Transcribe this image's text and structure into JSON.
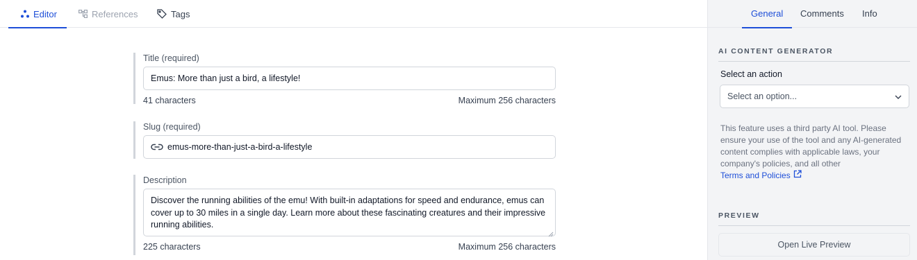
{
  "editor_tabs": {
    "editor": "Editor",
    "references": "References",
    "tags": "Tags"
  },
  "form": {
    "title": {
      "label": "Title (required)",
      "value": "Emus: More than just a bird, a lifestyle!",
      "count": "41 characters",
      "max": "Maximum 256 characters"
    },
    "slug": {
      "label": "Slug (required)",
      "value": "emus-more-than-just-a-bird-a-lifestyle",
      "icon": "link-icon"
    },
    "description": {
      "label": "Description",
      "value": "Discover the running abilities of the emu! With built-in adaptations for speed and endurance, emus can cover up to 30 miles in a single day. Learn more about these fascinating creatures and their impressive running abilities.",
      "count": "225 characters",
      "max": "Maximum 256 characters"
    }
  },
  "side_tabs": {
    "general": "General",
    "comments": "Comments",
    "info": "Info"
  },
  "ai_generator": {
    "heading": "AI CONTENT GENERATOR",
    "select_label": "Select an action",
    "select_value": "Select an option...",
    "disclaimer": "This feature uses a third party AI tool. Please ensure your use of the tool and any AI-generated content complies with applicable laws, your company's policies, and all other",
    "terms_link": "Terms and Policies"
  },
  "preview": {
    "heading": "PREVIEW",
    "button": "Open Live Preview"
  },
  "colors": {
    "accent": "#1d4ed8",
    "panel_bg": "#f3f4f6",
    "border": "#d1d5db"
  }
}
